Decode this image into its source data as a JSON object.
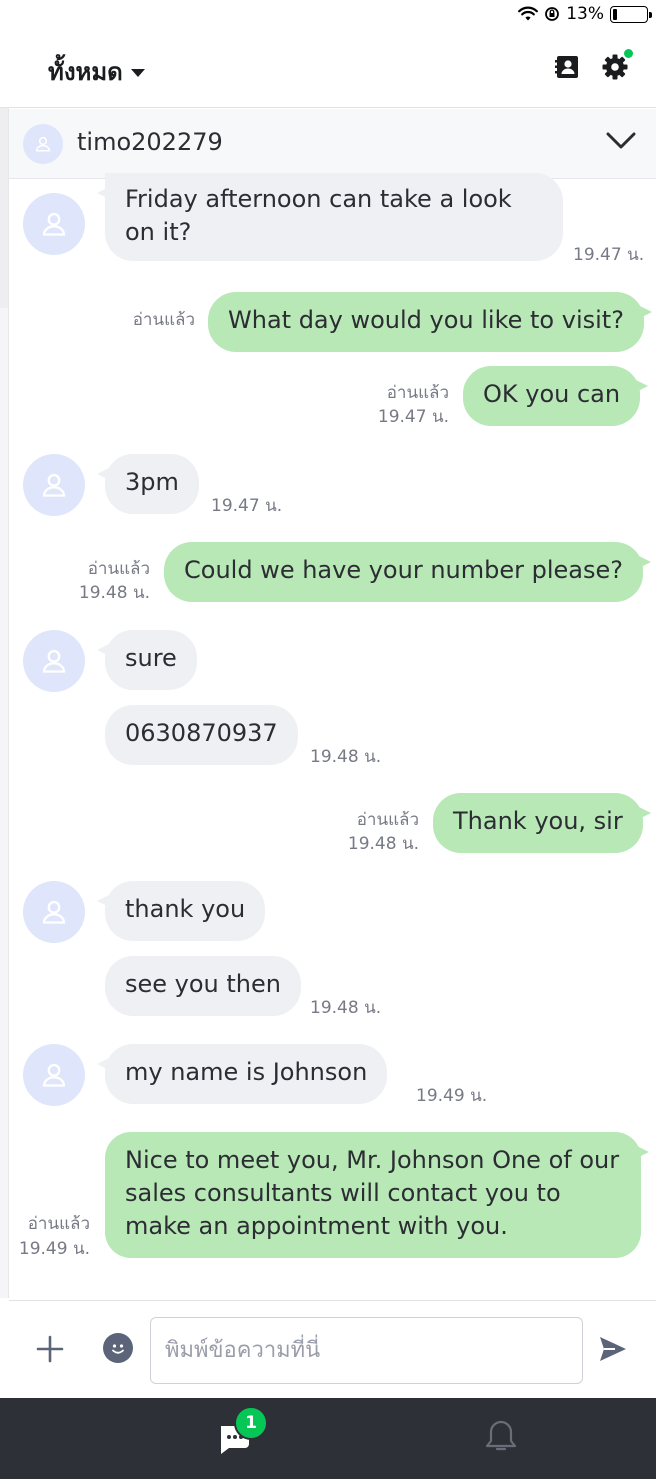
{
  "status_bar": {
    "battery_percent": "13%",
    "battery_level": 0.13,
    "icons": [
      "wifi-icon",
      "orientation-lock-icon",
      "battery-icon"
    ]
  },
  "header": {
    "title": "ทั้งหมด",
    "icons": [
      "contacts-icon",
      "settings-icon"
    ],
    "settings_dot_color": "#06c755"
  },
  "conversation": {
    "contact_name": "timo202279"
  },
  "messages": [
    {
      "side": "in",
      "text": "Friday afternoon can take a look on it?",
      "time": "19.47 น."
    },
    {
      "side": "out",
      "text": "What day would you like to visit?",
      "read": "อ่านแล้ว"
    },
    {
      "side": "out",
      "text": "OK you can",
      "read": "อ่านแล้ว",
      "time": "19.47 น."
    },
    {
      "side": "in",
      "text": "3pm",
      "time": "19.47 น."
    },
    {
      "side": "out",
      "text": "Could we have your number please?",
      "read": "อ่านแล้ว",
      "time": "19.48 น."
    },
    {
      "side": "in",
      "text": "sure"
    },
    {
      "side": "in",
      "text": "0630870937",
      "time": "19.48 น."
    },
    {
      "side": "out",
      "text": "Thank you, sir",
      "read": "อ่านแล้ว",
      "time": "19.48 น."
    },
    {
      "side": "in",
      "text": "thank you"
    },
    {
      "side": "in",
      "text": "see you then",
      "time": "19.48 น."
    },
    {
      "side": "in",
      "text": "my name is Johnson",
      "time": "19.49 น."
    },
    {
      "side": "out",
      "text": "Nice to meet you, Mr. Johnson One of our sales consultants will contact you to make an appointment with you.",
      "read": "อ่านแล้ว",
      "time": "19.49 น."
    }
  ],
  "input": {
    "placeholder": "พิมพ์ข้อความที่นี่",
    "icons": [
      "plus-icon",
      "emoji-icon",
      "send-icon"
    ]
  },
  "bottom_nav": {
    "chat_badge": "1",
    "icons": [
      "chat-icon",
      "bell-icon"
    ]
  },
  "colors": {
    "incoming_bubble": "#eff0f3",
    "outgoing_bubble": "#b7e8b6",
    "accent_green": "#06c755",
    "nav_background": "#2e3038"
  }
}
